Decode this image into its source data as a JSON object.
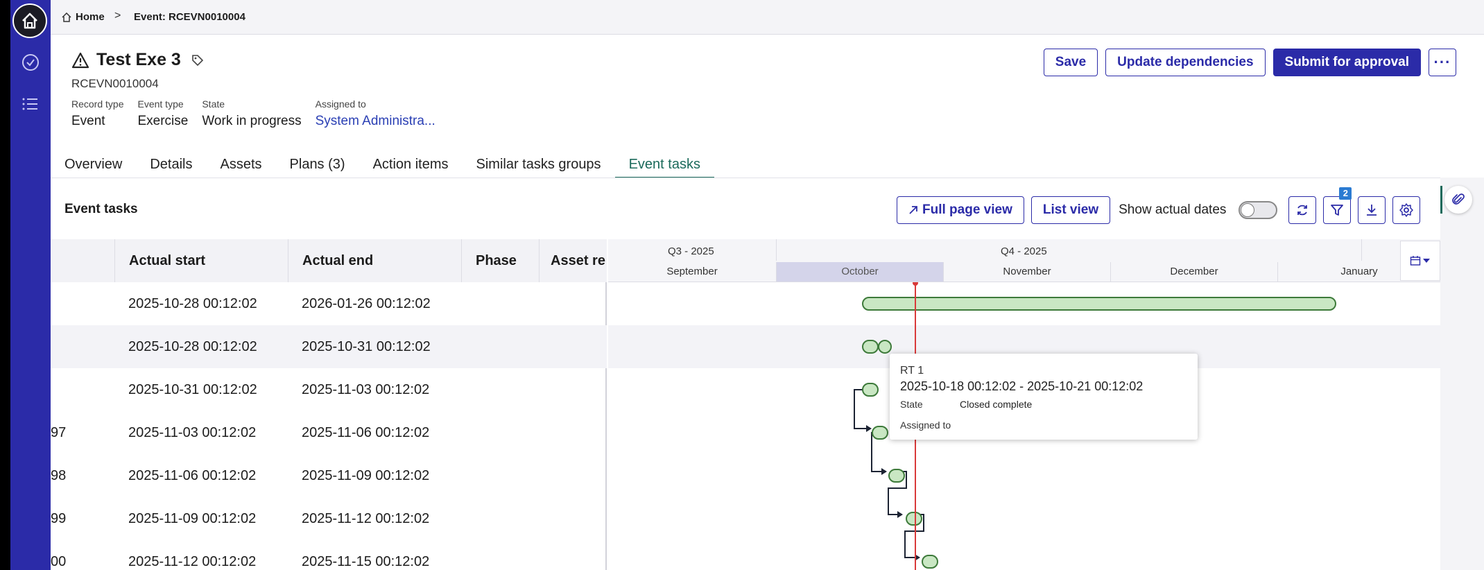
{
  "breadcrumb": {
    "home": "Home",
    "separator": ">",
    "current": "Event: RCEVN0010004"
  },
  "record": {
    "title": "Test Exe 3",
    "number": "RCEVN0010004",
    "fields": [
      {
        "label": "Record type",
        "value": "Event"
      },
      {
        "label": "Event type",
        "value": "Exercise"
      },
      {
        "label": "State",
        "value": "Work in progress"
      },
      {
        "label": "Assigned to",
        "value": "System Administra..."
      }
    ]
  },
  "actions": {
    "save": "Save",
    "update_dependencies": "Update dependencies",
    "submit": "Submit for approval",
    "more": "···"
  },
  "tabs": [
    "Overview",
    "Details",
    "Assets",
    "Plans (3)",
    "Action items",
    "Similar tasks groups",
    "Event tasks"
  ],
  "active_tab": "Event tasks",
  "section": {
    "title": "Event tasks",
    "full_page": "Full page view",
    "list_view": "List view",
    "show_actual_dates": "Show actual dates",
    "filter_count": "2"
  },
  "grid": {
    "columns": [
      "Actual start",
      "Actual end",
      "Phase",
      "Asset re"
    ],
    "rows": [
      {
        "id": "",
        "start": "2025-10-28 00:12:02",
        "end": "2026-01-26 00:12:02"
      },
      {
        "id": "",
        "start": "2025-10-28 00:12:02",
        "end": "2025-10-31 00:12:02"
      },
      {
        "id": "",
        "start": "2025-10-31 00:12:02",
        "end": "2025-11-03 00:12:02"
      },
      {
        "id": "97",
        "start": "2025-11-03 00:12:02",
        "end": "2025-11-06 00:12:02"
      },
      {
        "id": "98",
        "start": "2025-11-06 00:12:02",
        "end": "2025-11-09 00:12:02"
      },
      {
        "id": "99",
        "start": "2025-11-09 00:12:02",
        "end": "2025-11-12 00:12:02"
      },
      {
        "id": "00",
        "start": "2025-11-12 00:12:02",
        "end": "2025-11-15 00:12:02"
      }
    ]
  },
  "gantt": {
    "quarters": [
      "Q3 - 2025",
      "Q4 - 2025"
    ],
    "months": [
      "September",
      "October",
      "November",
      "December",
      "January"
    ],
    "selected_month": "October"
  },
  "tooltip": {
    "name": "RT 1",
    "dates": "2025-10-18 00:12:02 - 2025-10-21 00:12:02",
    "state_label": "State",
    "state_value": "Closed complete",
    "assigned_label": "Assigned to"
  },
  "colors": {
    "brand": "#2b2ba8",
    "active_tab": "#1b6a5b",
    "today_line": "#d93a3a",
    "bar_fill": "#c9e7c3",
    "bar_stroke": "#3d7a3a",
    "link": "#2a3fb4"
  },
  "icons": [
    "home-icon",
    "check-circle-icon",
    "list-icon",
    "warning-icon",
    "tag-icon",
    "refresh-icon",
    "filter-icon",
    "download-icon",
    "gear-icon",
    "calendar-icon",
    "paperclip-icon"
  ]
}
